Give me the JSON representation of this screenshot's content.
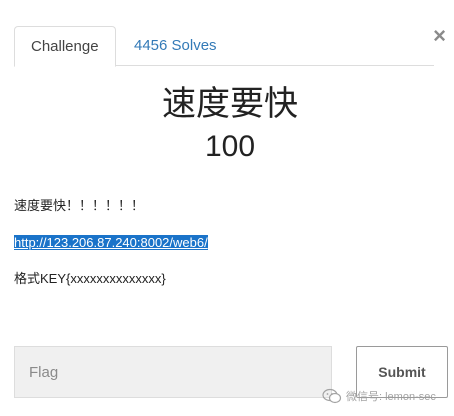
{
  "tabs": [
    {
      "label": "Challenge",
      "active": true
    },
    {
      "label": "4456 Solves",
      "active": false
    }
  ],
  "close_label": "×",
  "challenge": {
    "name": "速度要快",
    "points": "100",
    "description_line": "速度要快！！！！！！",
    "link": "http://123.206.87.240:8002/web6/",
    "format_hint": "格式KEY{xxxxxxxxxxxxxx}"
  },
  "form": {
    "flag_placeholder": "Flag",
    "submit_label": "Submit"
  },
  "watermark": {
    "text": "微信号: lemon-sec"
  },
  "colors": {
    "link_highlight": "#1a73c9",
    "tab_link": "#337ab7",
    "input_bg": "#f0f0f0"
  }
}
